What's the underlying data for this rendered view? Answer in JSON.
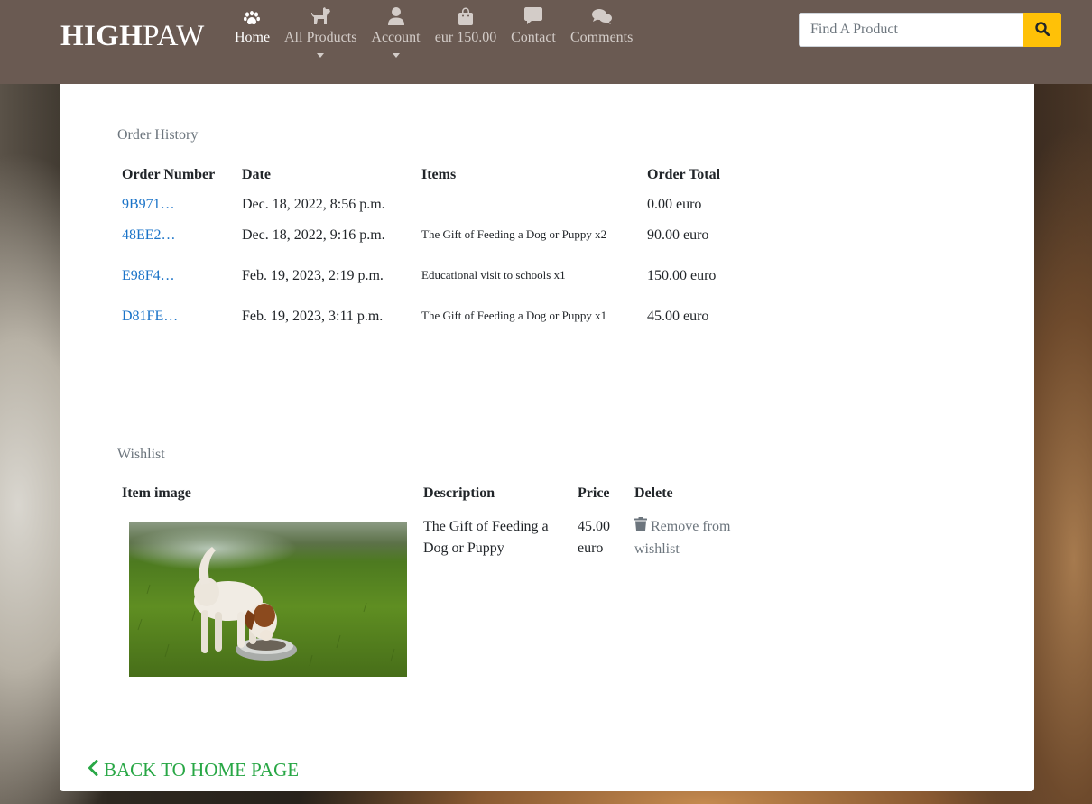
{
  "brand": {
    "part1": "HIGH",
    "part2": "PAW"
  },
  "nav": {
    "home": "Home",
    "all_products": "All Products",
    "account": "Account",
    "bag": "eur 150.00",
    "contact": "Contact",
    "comments": "Comments"
  },
  "search": {
    "placeholder": "Find A Product"
  },
  "order_history": {
    "title": "Order History",
    "headers": [
      "Order Number",
      "Date",
      "Items",
      "Order Total"
    ],
    "rows": [
      {
        "number": "9B971…",
        "date": "Dec. 18, 2022, 8:56 p.m.",
        "items": "",
        "total": "0.00 euro"
      },
      {
        "number": "48EE2…",
        "date": "Dec. 18, 2022, 9:16 p.m.",
        "items": "The Gift of Feeding a Dog or Puppy x2",
        "total": "90.00 euro"
      },
      {
        "number": "E98F4…",
        "date": "Feb. 19, 2023, 2:19 p.m.",
        "items": "Educational visit to schools x1",
        "total": "150.00 euro"
      },
      {
        "number": "D81FE…",
        "date": "Feb. 19, 2023, 3:11 p.m.",
        "items": "The Gift of Feeding a Dog or Puppy x1",
        "total": "45.00 euro"
      }
    ]
  },
  "wishlist": {
    "title": "Wishlist",
    "headers": [
      "Item image",
      "Description",
      "Price",
      "Delete"
    ],
    "items": [
      {
        "description": "The Gift of Feeding a Dog or Puppy",
        "price": "45.00 euro",
        "remove": "Remove from wishlist"
      }
    ]
  },
  "back_link": "BACK TO HOME PAGE",
  "colors": {
    "navbar": "#6a5a52",
    "search_button": "#ffc107",
    "link": "#1a73c8",
    "back_link": "#28a745"
  }
}
